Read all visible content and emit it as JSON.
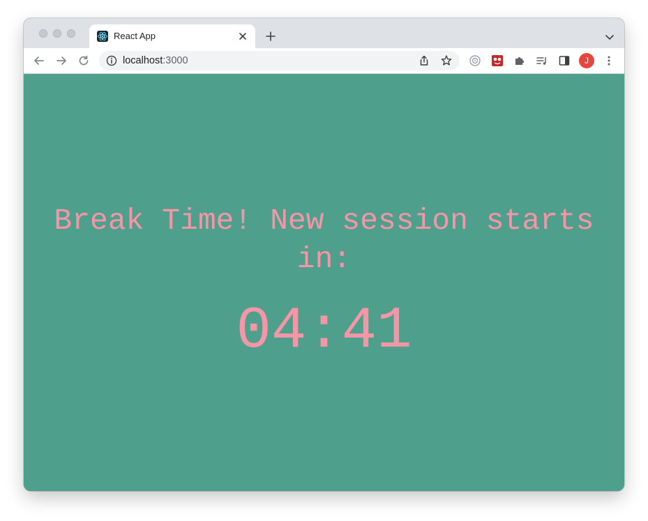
{
  "browser": {
    "tab": {
      "title": "React App",
      "favicon": "react-logo-icon"
    },
    "address": {
      "host": "localhost",
      "port": ":3000"
    },
    "profile_initial": "J",
    "colors": {
      "avatar": "#e8453c",
      "tabstrip": "#dee1e6"
    }
  },
  "page": {
    "message": "Break Time! New session starts in:",
    "countdown": "04:41",
    "colors": {
      "background": "#4ea08d",
      "text": "#f496a6"
    }
  }
}
